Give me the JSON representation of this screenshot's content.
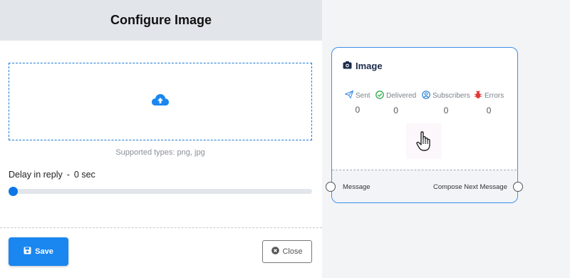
{
  "panel": {
    "title": "Configure Image",
    "supported_types": "Supported types: png, jpg",
    "delay_label": "Delay in reply",
    "delay_separator": "-",
    "delay_value": "0 sec",
    "slider_value": 0,
    "save_label": "Save",
    "close_label": "Close"
  },
  "node": {
    "title": "Image",
    "stats": [
      {
        "label": "Sent",
        "value": "0",
        "icon": "paper-plane-icon"
      },
      {
        "label": "Delivered",
        "value": "0",
        "icon": "check-circle-icon"
      },
      {
        "label": "Subscribers",
        "value": "0",
        "icon": "user-circle-icon"
      },
      {
        "label": "Errors",
        "value": "0",
        "icon": "bug-icon"
      }
    ],
    "port_left": "Message",
    "port_right": "Compose Next Message"
  },
  "colors": {
    "accent": "#1a86f0",
    "sent": "#3a8ee6",
    "delivered": "#2fa84f",
    "subscribers": "#2a7fd4",
    "errors": "#e53935"
  }
}
